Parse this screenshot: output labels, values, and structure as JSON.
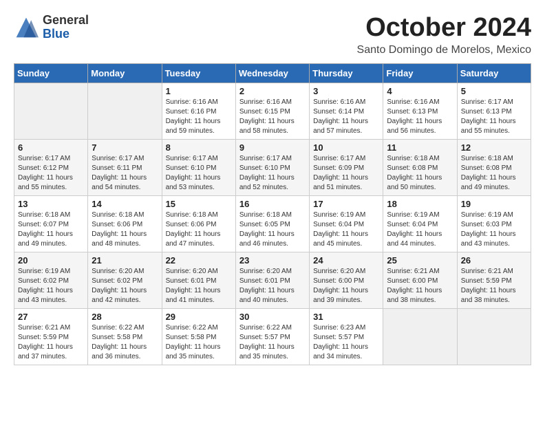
{
  "logo": {
    "general": "General",
    "blue": "Blue"
  },
  "title": "October 2024",
  "location": "Santo Domingo de Morelos, Mexico",
  "days_of_week": [
    "Sunday",
    "Monday",
    "Tuesday",
    "Wednesday",
    "Thursday",
    "Friday",
    "Saturday"
  ],
  "weeks": [
    [
      {
        "day": "",
        "info": ""
      },
      {
        "day": "",
        "info": ""
      },
      {
        "day": "1",
        "info": "Sunrise: 6:16 AM\nSunset: 6:16 PM\nDaylight: 11 hours and 59 minutes."
      },
      {
        "day": "2",
        "info": "Sunrise: 6:16 AM\nSunset: 6:15 PM\nDaylight: 11 hours and 58 minutes."
      },
      {
        "day": "3",
        "info": "Sunrise: 6:16 AM\nSunset: 6:14 PM\nDaylight: 11 hours and 57 minutes."
      },
      {
        "day": "4",
        "info": "Sunrise: 6:16 AM\nSunset: 6:13 PM\nDaylight: 11 hours and 56 minutes."
      },
      {
        "day": "5",
        "info": "Sunrise: 6:17 AM\nSunset: 6:13 PM\nDaylight: 11 hours and 55 minutes."
      }
    ],
    [
      {
        "day": "6",
        "info": "Sunrise: 6:17 AM\nSunset: 6:12 PM\nDaylight: 11 hours and 55 minutes."
      },
      {
        "day": "7",
        "info": "Sunrise: 6:17 AM\nSunset: 6:11 PM\nDaylight: 11 hours and 54 minutes."
      },
      {
        "day": "8",
        "info": "Sunrise: 6:17 AM\nSunset: 6:10 PM\nDaylight: 11 hours and 53 minutes."
      },
      {
        "day": "9",
        "info": "Sunrise: 6:17 AM\nSunset: 6:10 PM\nDaylight: 11 hours and 52 minutes."
      },
      {
        "day": "10",
        "info": "Sunrise: 6:17 AM\nSunset: 6:09 PM\nDaylight: 11 hours and 51 minutes."
      },
      {
        "day": "11",
        "info": "Sunrise: 6:18 AM\nSunset: 6:08 PM\nDaylight: 11 hours and 50 minutes."
      },
      {
        "day": "12",
        "info": "Sunrise: 6:18 AM\nSunset: 6:08 PM\nDaylight: 11 hours and 49 minutes."
      }
    ],
    [
      {
        "day": "13",
        "info": "Sunrise: 6:18 AM\nSunset: 6:07 PM\nDaylight: 11 hours and 49 minutes."
      },
      {
        "day": "14",
        "info": "Sunrise: 6:18 AM\nSunset: 6:06 PM\nDaylight: 11 hours and 48 minutes."
      },
      {
        "day": "15",
        "info": "Sunrise: 6:18 AM\nSunset: 6:06 PM\nDaylight: 11 hours and 47 minutes."
      },
      {
        "day": "16",
        "info": "Sunrise: 6:18 AM\nSunset: 6:05 PM\nDaylight: 11 hours and 46 minutes."
      },
      {
        "day": "17",
        "info": "Sunrise: 6:19 AM\nSunset: 6:04 PM\nDaylight: 11 hours and 45 minutes."
      },
      {
        "day": "18",
        "info": "Sunrise: 6:19 AM\nSunset: 6:04 PM\nDaylight: 11 hours and 44 minutes."
      },
      {
        "day": "19",
        "info": "Sunrise: 6:19 AM\nSunset: 6:03 PM\nDaylight: 11 hours and 43 minutes."
      }
    ],
    [
      {
        "day": "20",
        "info": "Sunrise: 6:19 AM\nSunset: 6:02 PM\nDaylight: 11 hours and 43 minutes."
      },
      {
        "day": "21",
        "info": "Sunrise: 6:20 AM\nSunset: 6:02 PM\nDaylight: 11 hours and 42 minutes."
      },
      {
        "day": "22",
        "info": "Sunrise: 6:20 AM\nSunset: 6:01 PM\nDaylight: 11 hours and 41 minutes."
      },
      {
        "day": "23",
        "info": "Sunrise: 6:20 AM\nSunset: 6:01 PM\nDaylight: 11 hours and 40 minutes."
      },
      {
        "day": "24",
        "info": "Sunrise: 6:20 AM\nSunset: 6:00 PM\nDaylight: 11 hours and 39 minutes."
      },
      {
        "day": "25",
        "info": "Sunrise: 6:21 AM\nSunset: 6:00 PM\nDaylight: 11 hours and 38 minutes."
      },
      {
        "day": "26",
        "info": "Sunrise: 6:21 AM\nSunset: 5:59 PM\nDaylight: 11 hours and 38 minutes."
      }
    ],
    [
      {
        "day": "27",
        "info": "Sunrise: 6:21 AM\nSunset: 5:59 PM\nDaylight: 11 hours and 37 minutes."
      },
      {
        "day": "28",
        "info": "Sunrise: 6:22 AM\nSunset: 5:58 PM\nDaylight: 11 hours and 36 minutes."
      },
      {
        "day": "29",
        "info": "Sunrise: 6:22 AM\nSunset: 5:58 PM\nDaylight: 11 hours and 35 minutes."
      },
      {
        "day": "30",
        "info": "Sunrise: 6:22 AM\nSunset: 5:57 PM\nDaylight: 11 hours and 35 minutes."
      },
      {
        "day": "31",
        "info": "Sunrise: 6:23 AM\nSunset: 5:57 PM\nDaylight: 11 hours and 34 minutes."
      },
      {
        "day": "",
        "info": ""
      },
      {
        "day": "",
        "info": ""
      }
    ]
  ]
}
